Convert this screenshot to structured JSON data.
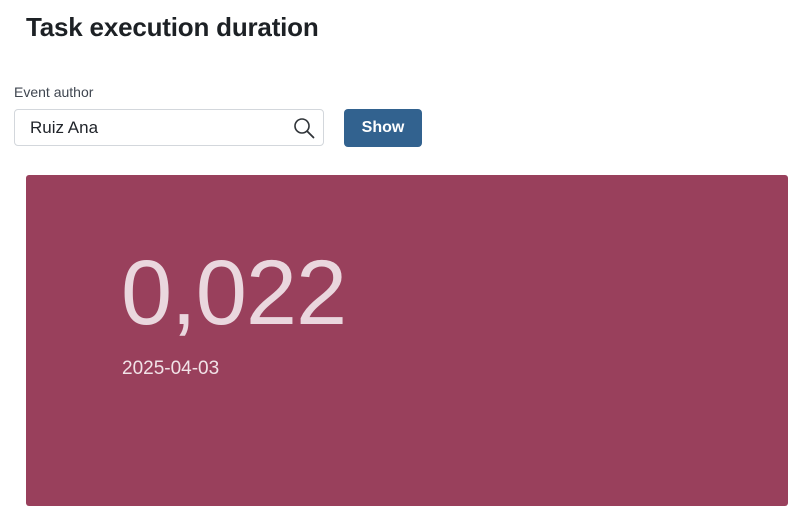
{
  "page": {
    "title": "Task execution duration"
  },
  "filter": {
    "label": "Event author",
    "value": "Ruiz Ana",
    "search_icon": "search-icon",
    "show_label": "Show",
    "show_color": "#32628f"
  },
  "kpi": {
    "value": "0,022",
    "date": "2025-04-03",
    "background_color": "#99405c"
  }
}
